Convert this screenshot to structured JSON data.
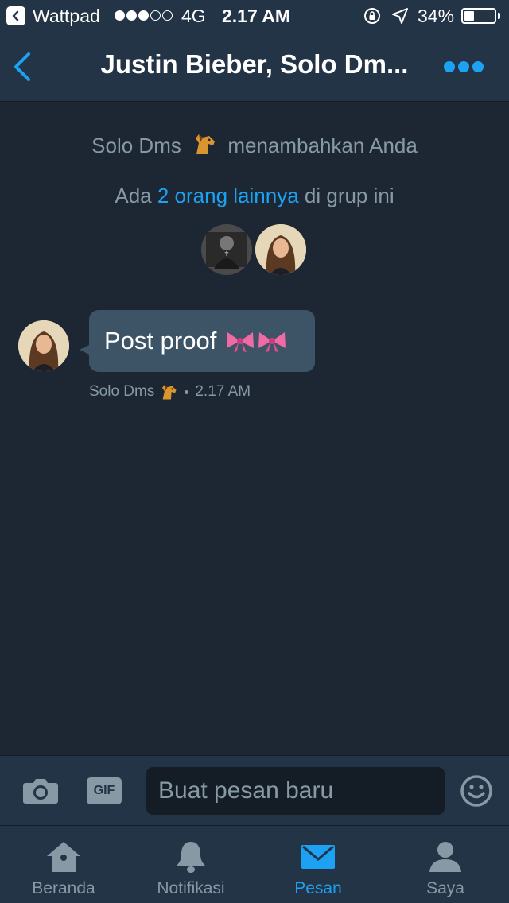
{
  "status_bar": {
    "back_app": "Wattpad",
    "signal_dots": [
      true,
      true,
      true,
      false,
      false
    ],
    "network": "4G",
    "time": "2.17 AM",
    "battery": "34%",
    "battery_level": 0.34
  },
  "nav": {
    "title": "Justin Bieber, Solo Dm...",
    "back_icon": "chevron-left-icon",
    "more_icon": "more-dots-icon"
  },
  "conversation": {
    "added_prefix": "Solo Dms",
    "added_suffix": "menambahkan Anda",
    "group_prefix": "Ada ",
    "group_link": "2 orang lainnya",
    "group_suffix": " di grup ini",
    "messages": [
      {
        "text": "Post proof",
        "sender": "Solo Dms",
        "time": "2.17 AM"
      }
    ]
  },
  "composer": {
    "gif_label": "GIF",
    "placeholder": "Buat pesan baru"
  },
  "tabs": [
    {
      "label": "Beranda",
      "icon": "home-icon",
      "active": false
    },
    {
      "label": "Notifikasi",
      "icon": "bell-icon",
      "active": false
    },
    {
      "label": "Pesan",
      "icon": "envelope-icon",
      "active": true
    },
    {
      "label": "Saya",
      "icon": "person-icon",
      "active": false
    }
  ],
  "colors": {
    "background": "#1c2733",
    "bar": "#243447",
    "accent": "#1da1f2",
    "muted_text": "#8899a6",
    "bubble": "#3d5466"
  }
}
